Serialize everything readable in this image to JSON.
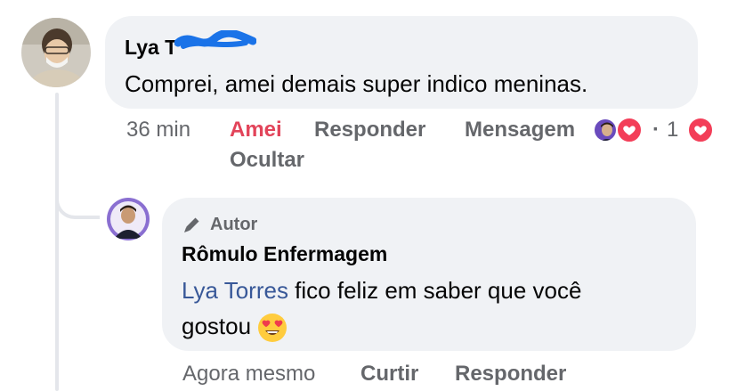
{
  "comment": {
    "author": "Lya T",
    "text": "Comprei,  amei demais super indico meninas.",
    "time": "36 min",
    "liked_label": "Amei",
    "reply_label": "Responder",
    "message_label": "Mensagem",
    "reaction_count": "1",
    "hide_label": "Ocultar",
    "separator": "·"
  },
  "reply": {
    "badge_label": "Autor",
    "author": "Rômulo Enfermagem",
    "mention": "Lya Torres",
    "text_line1": " fico feliz em saber que você",
    "text_line2": "gostou",
    "time": "Agora mesmo",
    "like_label": "Curtir",
    "reply_label": "Responder"
  },
  "colors": {
    "bubble": "#f0f2f5",
    "meta_text": "#65676b",
    "loved": "#e2445a",
    "mention": "#385898",
    "heart": "#f33e58",
    "redact_scribble": "#1a73e8"
  },
  "icons": [
    "user-avatar-photo",
    "author-avatar-photo",
    "pen-icon",
    "heart-icon",
    "heart-eyes-emoji"
  ]
}
